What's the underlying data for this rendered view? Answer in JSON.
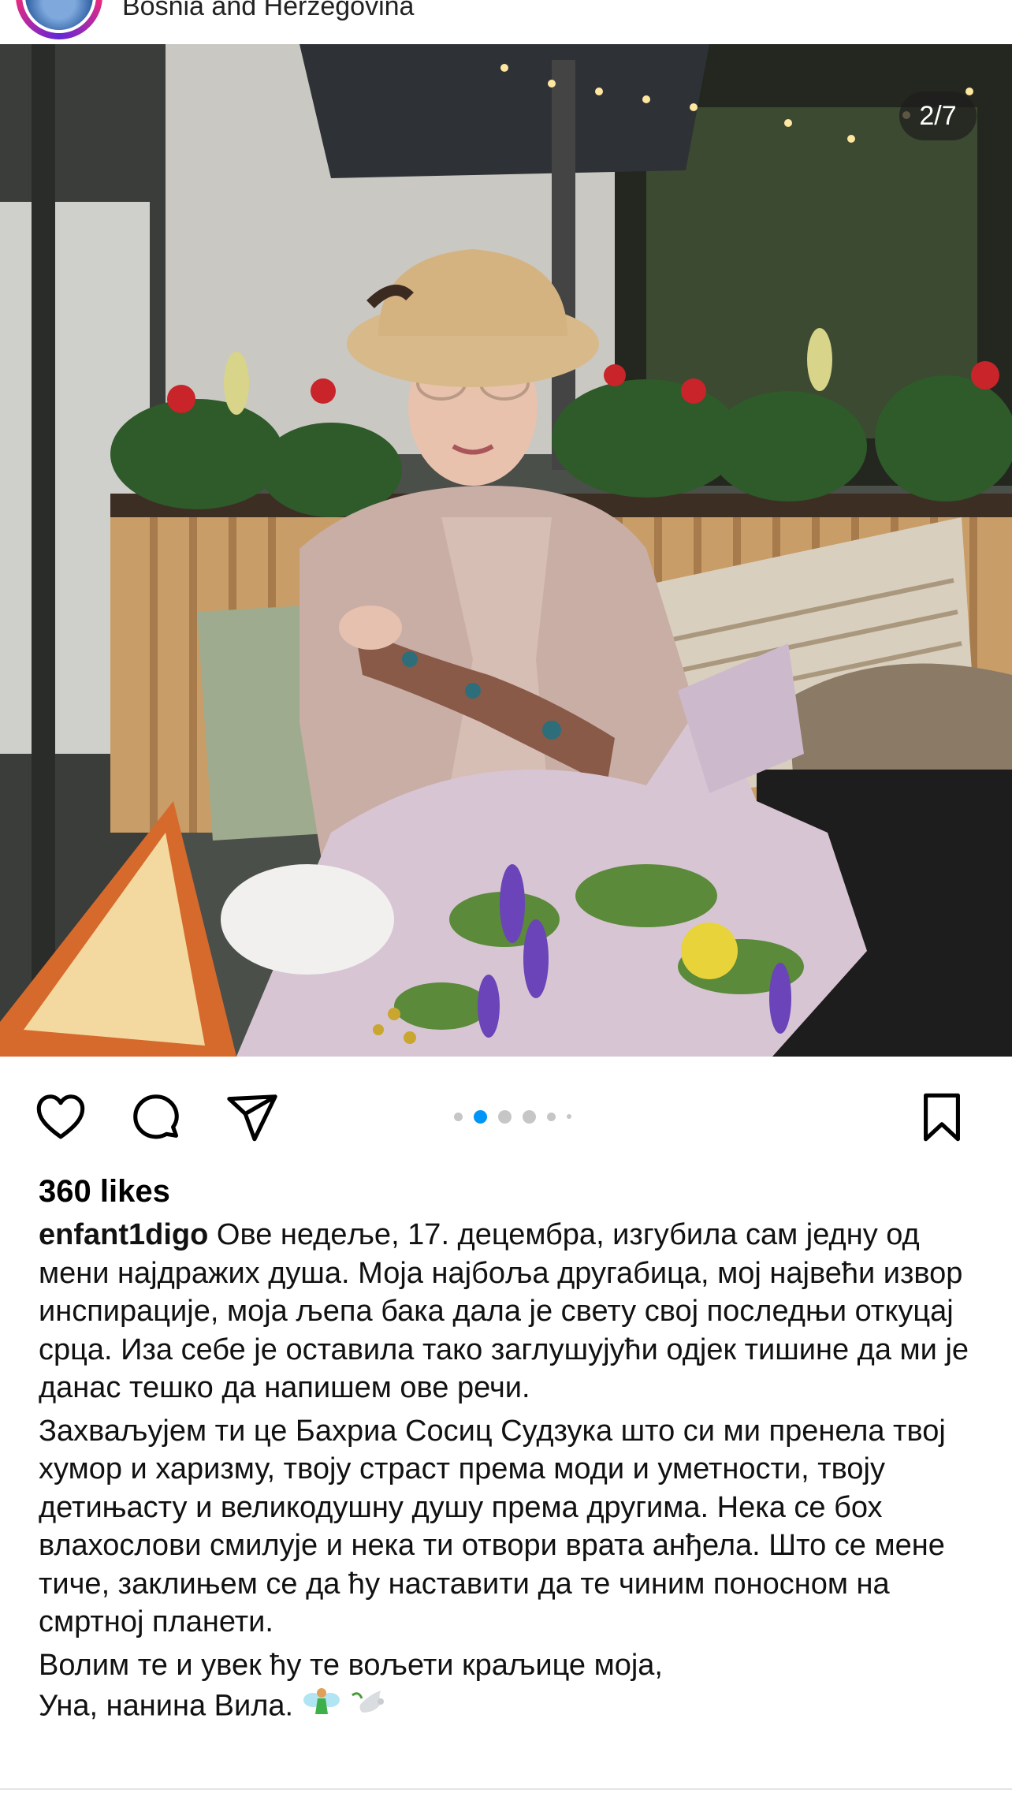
{
  "post": {
    "location": "Bosnia and Herzegovina",
    "image_counter": "2/7",
    "carousel": {
      "total_dots": 6,
      "active_index": 1
    },
    "likes": "360 likes",
    "username": "enfant1digo",
    "caption": {
      "p1": "Ове недеље, 17. децембра, изгубила сам једну од мени најдражих душа. Моја најбоља другабица, мој највећи извор инспирације, моја љепа бака дала је свету свој последњи откуцај срца. Иза себе је оставила тако заглушујући одјек тишине да ми је данас тешко да напишем ове речи.",
      "p2": "Захваљујем ти це Бахриа Сосиц Судзука што си ми пренела твој хумор и  харизму, твоју страст према моди и уметности, твоју детињасту и великодушну душу према другима. Нека се бох влахослови смилује и нека ти отвори врата анђела. Што се мене тиче, заклињем се да ћу наставити да те чиним поносном на смртној планети.",
      "p3_line1": "Волим те и увек ћу те вољети краљице моја,",
      "p3_line2": "Уна, нанина Вила."
    }
  },
  "icons": {
    "like": "heart-icon",
    "comment": "comment-bubble-icon",
    "share": "paper-plane-icon",
    "save": "bookmark-icon",
    "emoji1": "fairy-emoji-icon",
    "emoji2": "dove-emoji-icon"
  },
  "colors": {
    "active_dot": "#0095f6",
    "inactive_dot": "#c6c6c6",
    "text": "#111111"
  }
}
